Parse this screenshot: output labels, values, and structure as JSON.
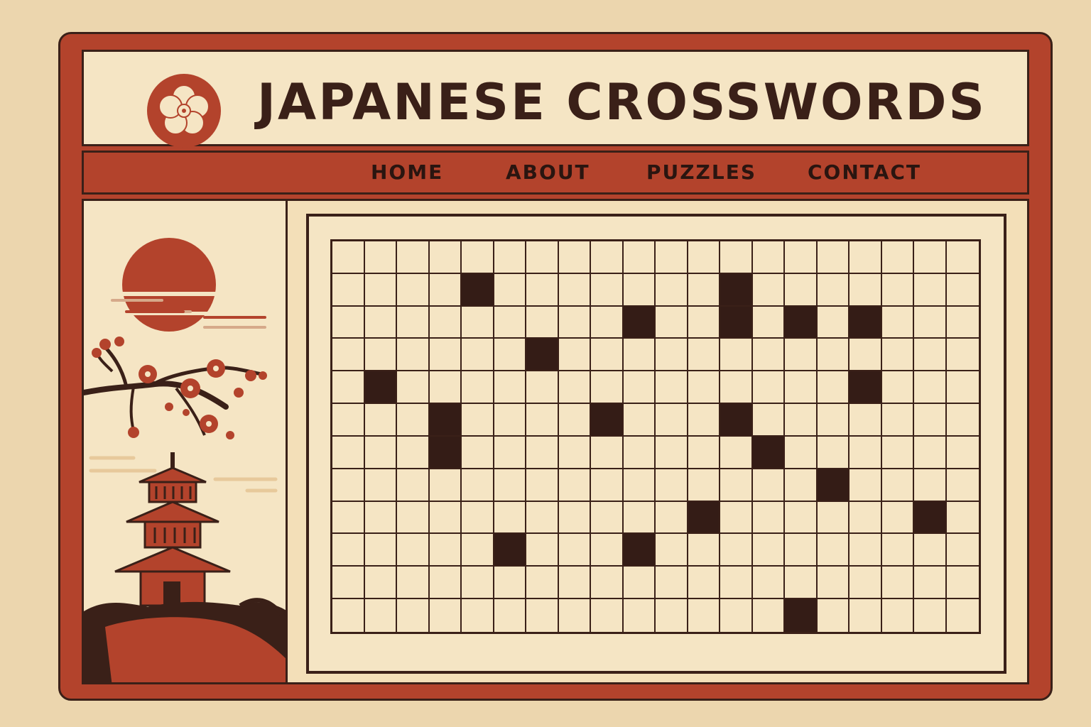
{
  "app": {
    "title": "JAPANESE CROSSWORDS",
    "logo_icon": "sakura-flower-icon"
  },
  "nav": {
    "items": [
      {
        "label": "HOME"
      },
      {
        "label": "ABOUT"
      },
      {
        "label": "PUZZLES"
      },
      {
        "label": "CONTACT"
      }
    ]
  },
  "sidebar": {
    "illustration_icons": [
      "red-sun-icon",
      "cherry-blossom-branch-icon",
      "pagoda-icon",
      "hill-icon"
    ]
  },
  "puzzle": {
    "rows": 12,
    "cols": 20,
    "black_cells": [
      [
        1,
        4
      ],
      [
        1,
        12
      ],
      [
        2,
        9
      ],
      [
        2,
        12
      ],
      [
        2,
        14
      ],
      [
        2,
        16
      ],
      [
        3,
        6
      ],
      [
        4,
        1
      ],
      [
        4,
        16
      ],
      [
        5,
        3
      ],
      [
        5,
        8
      ],
      [
        5,
        12
      ],
      [
        6,
        3
      ],
      [
        6,
        13
      ],
      [
        7,
        15
      ],
      [
        8,
        11
      ],
      [
        8,
        18
      ],
      [
        9,
        5
      ],
      [
        9,
        9
      ],
      [
        11,
        14
      ]
    ]
  },
  "colors": {
    "background": "#ecd6ae",
    "accent_red": "#b3432c",
    "cream": "#f5e5c4",
    "dark_brown": "#3a2018",
    "black_cell": "#341c16"
  }
}
